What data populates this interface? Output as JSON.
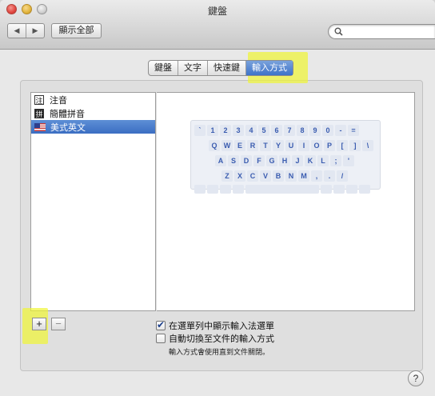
{
  "window": {
    "title": "鍵盤"
  },
  "toolbar": {
    "back_icon": "◀",
    "forward_icon": "▶",
    "show_all_label": "顯示全部",
    "search_placeholder": ""
  },
  "tabs": [
    {
      "label": "鍵盤",
      "active": false
    },
    {
      "label": "文字",
      "active": false
    },
    {
      "label": "快速鍵",
      "active": false
    },
    {
      "label": "輸入方式",
      "active": true
    }
  ],
  "input_sources": [
    {
      "label": "注音",
      "icon": "注",
      "icon_style": "light",
      "selected": false
    },
    {
      "label": "簡體拼音",
      "icon": "拼",
      "icon_style": "dark",
      "selected": false
    },
    {
      "label": "美式英文",
      "icon": "us-flag",
      "icon_style": "flag",
      "selected": true
    }
  ],
  "keyboard_rows": [
    [
      "`",
      "1",
      "2",
      "3",
      "4",
      "5",
      "6",
      "7",
      "8",
      "9",
      "0",
      "-",
      "="
    ],
    [
      "Q",
      "W",
      "E",
      "R",
      "T",
      "Y",
      "U",
      "I",
      "O",
      "P",
      "[",
      "]",
      "\\"
    ],
    [
      "A",
      "S",
      "D",
      "F",
      "G",
      "H",
      "J",
      "K",
      "L",
      ";",
      "'"
    ],
    [
      "Z",
      "X",
      "C",
      "V",
      "B",
      "N",
      "M",
      ",",
      ".",
      "/"
    ]
  ],
  "buttons": {
    "add_label": "+",
    "remove_label": "−",
    "help_label": "?"
  },
  "options": {
    "show_menu_label": "在選單列中顯示輸入法選單",
    "show_menu_checked": true,
    "auto_switch_label": "自動切換至文件的輸入方式",
    "auto_switch_checked": false,
    "note": "輸入方式會使用直到文件關閉。"
  },
  "colors": {
    "highlight": "#f0f532",
    "selection": "#3b6ec2",
    "key_text": "#3a5cb0"
  }
}
